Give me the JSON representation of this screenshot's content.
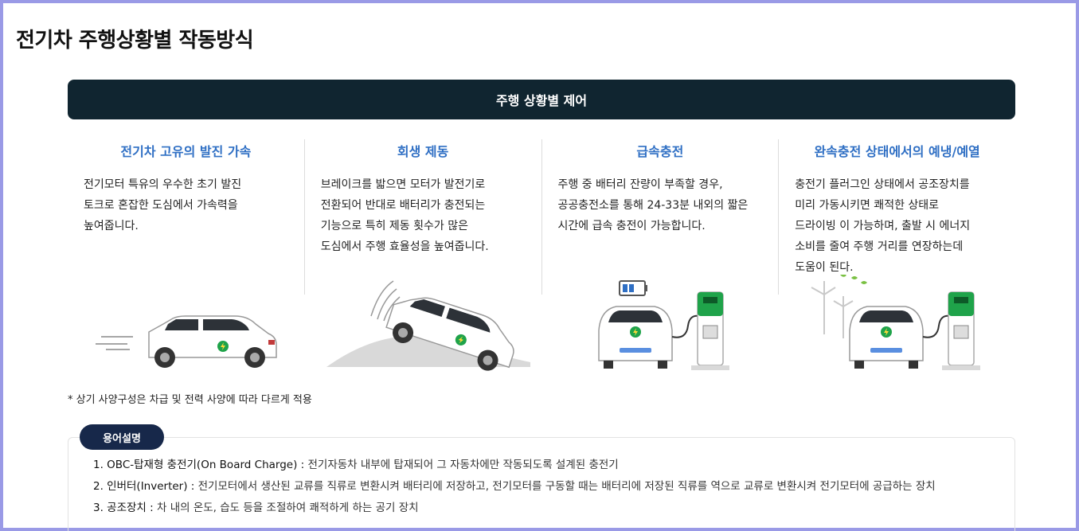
{
  "page": {
    "title": "전기차 주행상황별 작동방식"
  },
  "banner": {
    "label": "주행 상황별 제어"
  },
  "columns": [
    {
      "title": "전기차 고유의 발진 가속",
      "text": "전기모터 특유의 우수한 초기 발진\n토크로 혼잡한 도심에서 가속력을\n높여줍니다."
    },
    {
      "title": "회생 제동",
      "text": "브레이크를 밟으면 모터가 발전기로\n전환되어 반대로 배터리가 충전되는\n기능으로 특히 제동 횟수가 많은\n도심에서 주행 효율성을 높여줍니다."
    },
    {
      "title": "급속충전",
      "text": "주행 중 배터리 잔량이 부족할 경우,\n공공충전소를 통해 24-33분 내외의 짧은\n시간에 급속 충전이 가능합니다."
    },
    {
      "title": "완속충전 상태에서의 예냉/예열",
      "text": "충전기 플러그인 상태에서 공조장치를\n미리 가동시키면 쾌적한 상태로\n드라이빙 이 가능하며, 출발 시 에너지\n소비를 줄여 주행 거리를 연장하는데\n도움이 된다."
    }
  ],
  "footnote": "* 상기 사양구성은 차급 및 전력 사양에 따라 다르게 적용",
  "glossary": {
    "badge": "용어설명",
    "items": [
      {
        "term": "1. OBC-탑재형 충전기(On Board Charge) :",
        "desc": " 전기자동차 내부에 탑재되어 그 자동차에만 작동되도록 설계된 충전기"
      },
      {
        "term": "2. 인버터(Inverter) :",
        "desc": " 전기모터에서 생산된 교류를 직류로 변환시켜 배터리에 저장하고, 전기모터를 구동할 때는 배터리에 저장된 직류를 역으로 교류로 변환시켜 전기모터에 공급하는 장치"
      },
      {
        "term": "3. 공조장치 :",
        "desc": " 차 내의 온도, 습도 등을 조절하여 쾌적하게 하는 공기 장치"
      }
    ]
  },
  "colors": {
    "banner_bg": "#102530",
    "column_title": "#2f6fc4",
    "badge_bg": "#17284a",
    "ev_green": "#1fa34a",
    "frame": "#9a9ae6"
  },
  "icons": [
    "car-accelerating-illustration",
    "car-regen-braking-illustration",
    "fast-charging-illustration",
    "slow-charging-preconditioning-illustration"
  ]
}
